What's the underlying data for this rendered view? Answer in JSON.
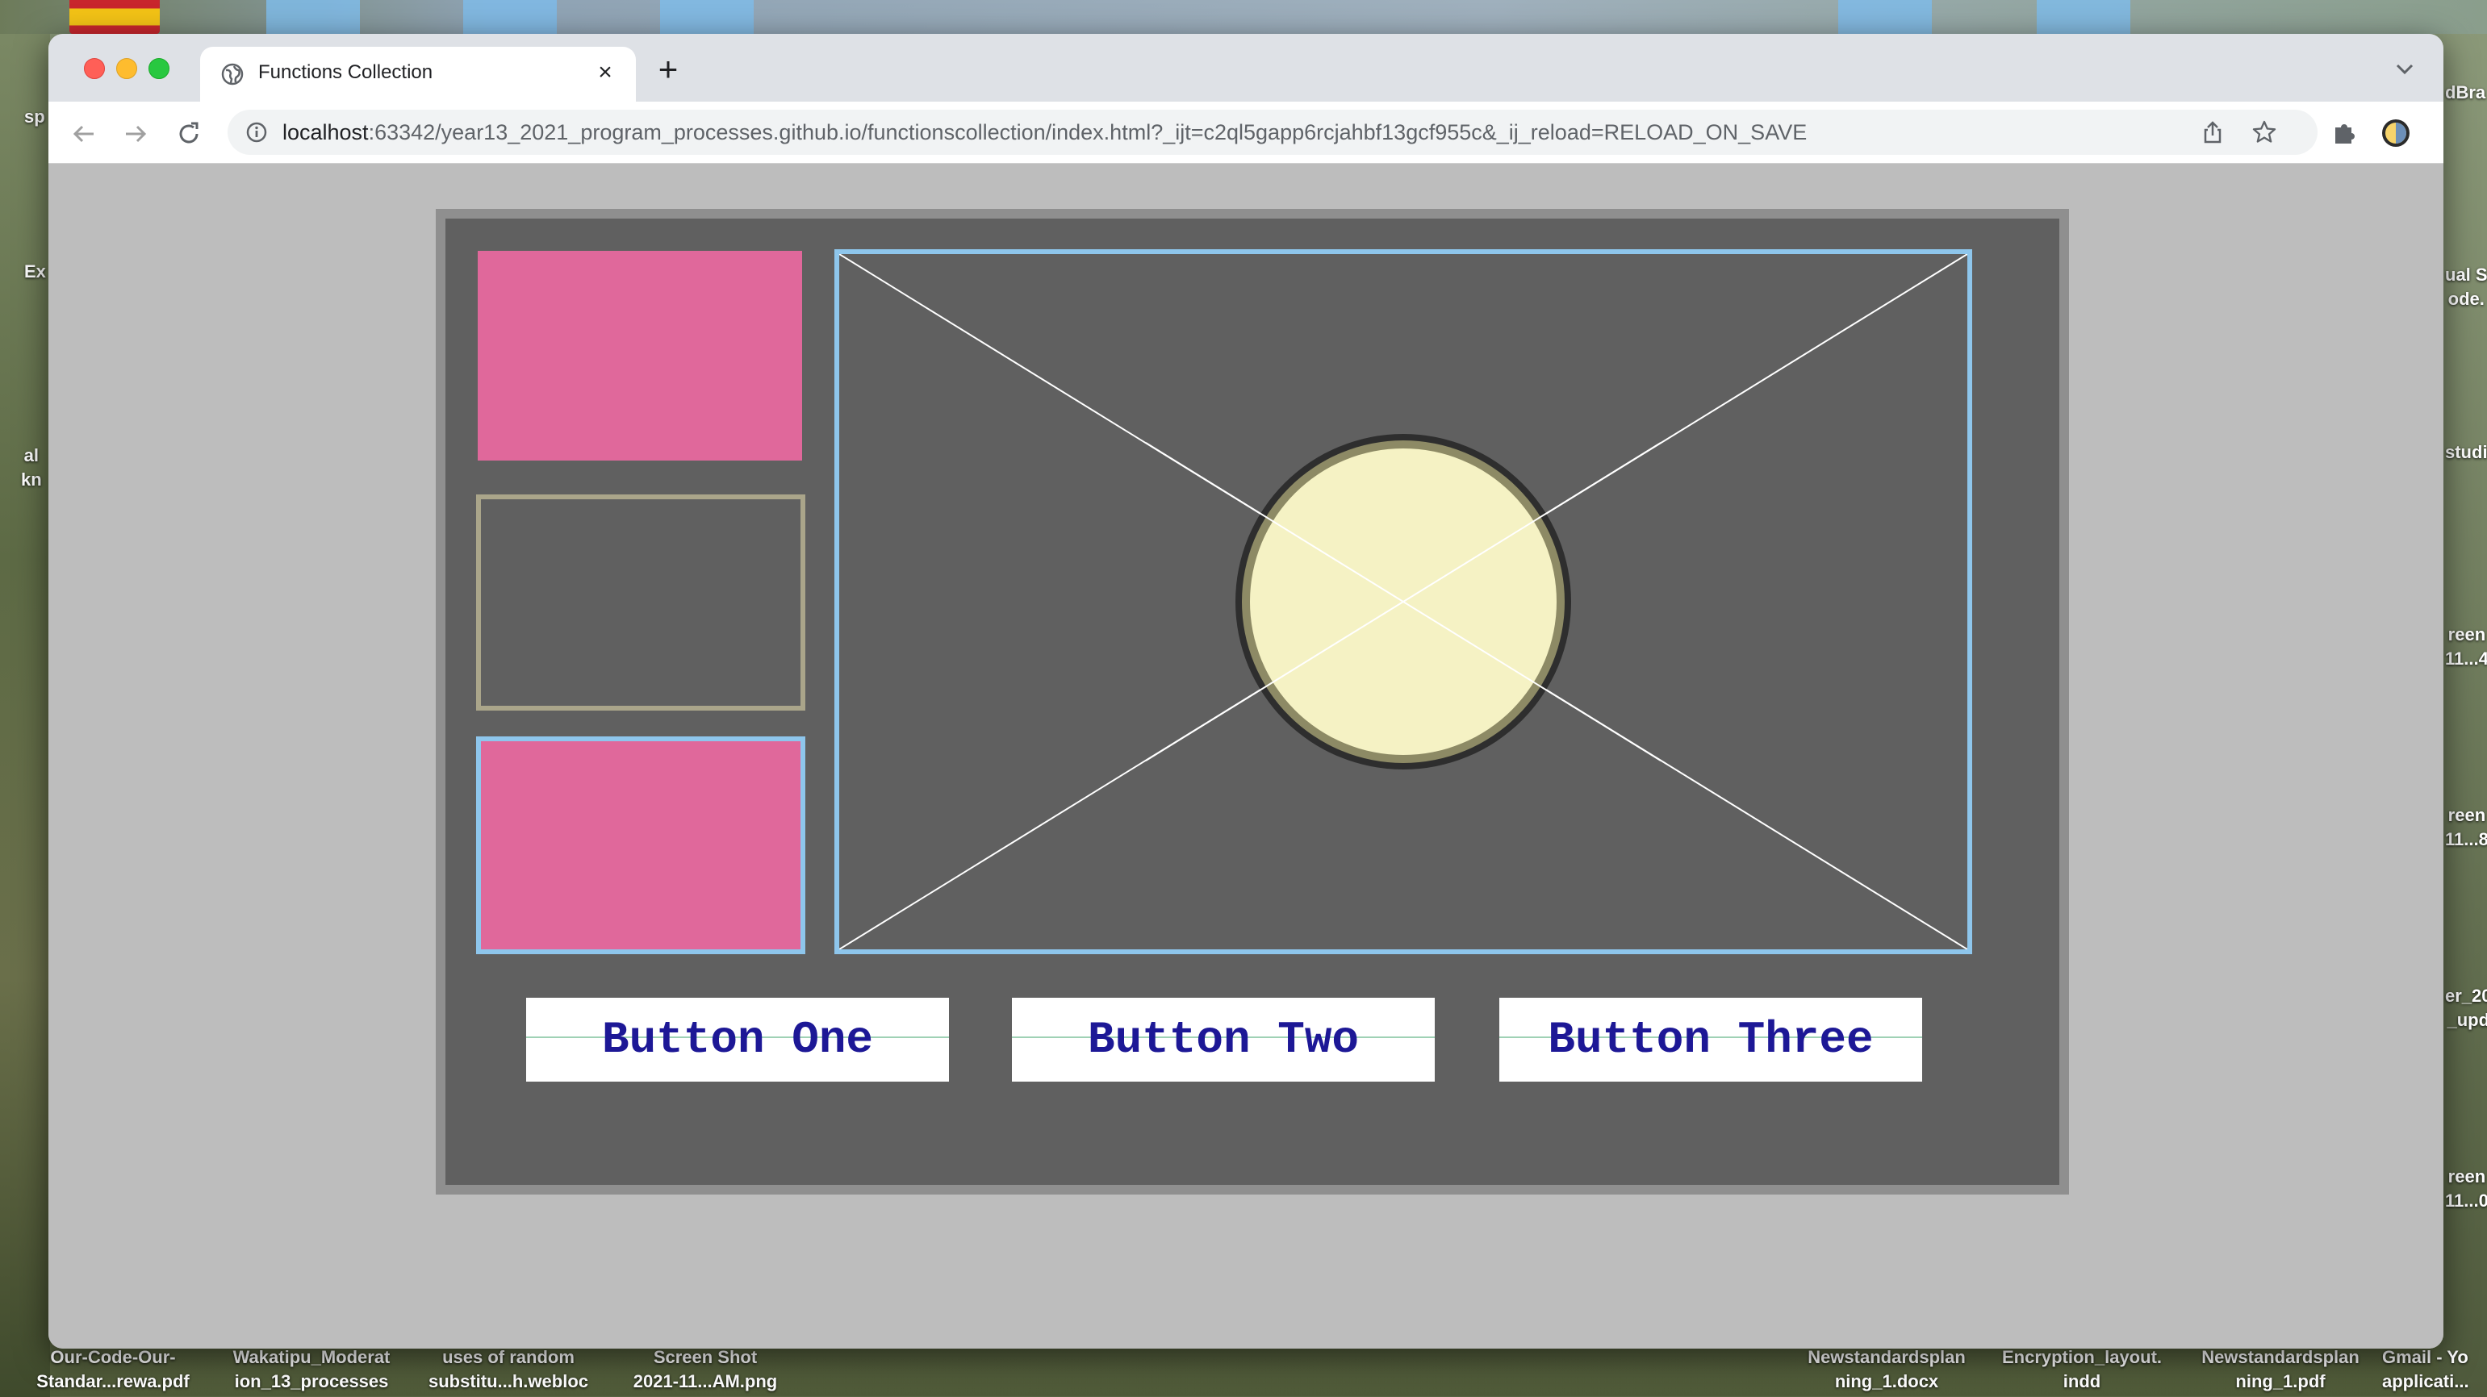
{
  "desktop": {
    "bottom_labels": [
      "Our-Code-Our-\nStandar...rewa.pdf",
      "Wakatipu_Moderat\nion_13_processes",
      "uses of random\nsubstitu...h.webloc",
      "Screen Shot\n2021-11...AM.png",
      "Newstandardsplan\nning_1.docx",
      "Encryption_layout.\nindd",
      "Newstandardsplan\nning_1.pdf",
      "Gmail - Yo\napplicati..."
    ],
    "left_labels": [
      "sp",
      "Ex",
      "al\nkn"
    ],
    "right_labels": [
      "dBra",
      "ual S\node.",
      "studi",
      "reen\n11...4",
      "reen\n11...8",
      "er_20\n_upd",
      "reen\n11...0"
    ]
  },
  "browser": {
    "tab_title": "Functions Collection",
    "url_host": "localhost",
    "url_rest": ":63342/year13_2021_program_processes.github.io/functionscollection/index.html?_ijt=c2ql5gapp6rcjahbf13gcf955c&_ij_reload=RELOAD_ON_SAVE"
  },
  "page": {
    "buttons": [
      "Button One",
      "Button Two",
      "Button Three"
    ]
  },
  "colors": {
    "pink_box": "#e0689b",
    "blue_border": "#8ec6ec",
    "tan_border": "#aaa58a",
    "circle_fill": "#f5f2c4",
    "panel_bg": "#606060",
    "button_text": "#1d1896"
  }
}
